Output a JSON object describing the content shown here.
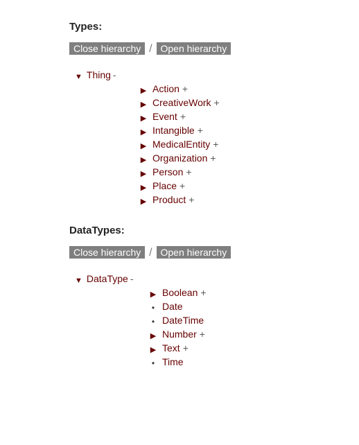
{
  "controls": {
    "close_label": "Close hierarchy",
    "open_label": "Open hierarchy",
    "separator": "/"
  },
  "types_section": {
    "heading": "Types:",
    "root": {
      "label": "Thing",
      "suffix": "-"
    },
    "children": [
      {
        "label": "Action",
        "expandable": true
      },
      {
        "label": "CreativeWork",
        "expandable": true
      },
      {
        "label": "Event",
        "expandable": true
      },
      {
        "label": "Intangible",
        "expandable": true
      },
      {
        "label": "MedicalEntity",
        "expandable": true
      },
      {
        "label": "Organization",
        "expandable": true
      },
      {
        "label": "Person",
        "expandable": true
      },
      {
        "label": "Place",
        "expandable": true
      },
      {
        "label": "Product",
        "expandable": true
      }
    ]
  },
  "datatypes_section": {
    "heading": "DataTypes:",
    "root": {
      "label": "DataType",
      "suffix": "-"
    },
    "children": [
      {
        "label": "Boolean",
        "expandable": true
      },
      {
        "label": "Date",
        "expandable": false
      },
      {
        "label": "DateTime",
        "expandable": false
      },
      {
        "label": "Number",
        "expandable": true
      },
      {
        "label": "Text",
        "expandable": true
      },
      {
        "label": "Time",
        "expandable": false
      }
    ]
  }
}
